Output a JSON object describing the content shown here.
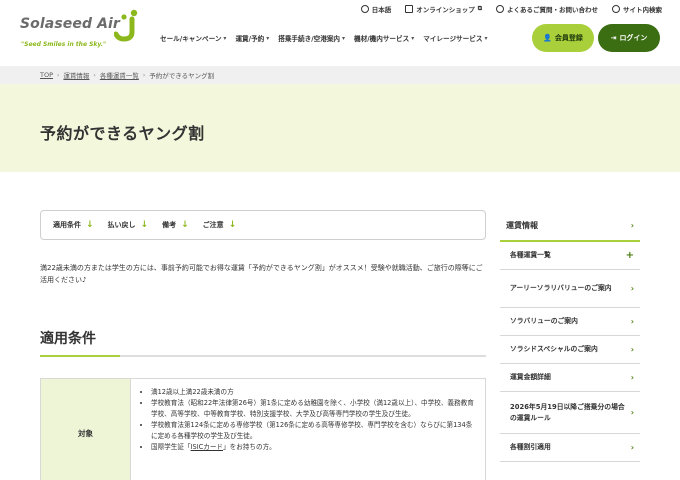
{
  "utility": {
    "language": "日本語",
    "shop": "オンラインショップ",
    "faq": "よくあるご質問・お問い合わせ",
    "search": "サイト内検索"
  },
  "brand": {
    "name": "Solaseed Air",
    "tagline": "\"Seed Smiles in the Sky.\"",
    "accent": "#a9d03a",
    "dark_green": "#3b6d12"
  },
  "gnav": [
    "セール/キャンペーン",
    "運賃/予約",
    "搭乗手続き/空港案内",
    "機材/機内サービス",
    "マイレージサービス"
  ],
  "buttons": {
    "member": "会員登録",
    "login": "ログイン"
  },
  "breadcrumb": [
    "TOP",
    "運賃情報",
    "各種運賃一覧",
    "予約ができるヤング割"
  ],
  "page_title": "予約ができるヤング割",
  "anchors": [
    "適用条件",
    "払い戻し",
    "備考",
    "ご注意"
  ],
  "intro": "満22歳未満の方または学生の方には、事前予約可能でお得な運賃「予約ができるヤング割」がオススメ！受験や就職活動、ご旅行の際等にご活用ください♪",
  "section_title": "適用条件",
  "table": {
    "head": "対象",
    "items": [
      "満12歳以上満22歳未満の方",
      "学校教育法（昭和22年法律第26号）第1条に定める幼稚園を除く、小学校（満12歳以上）、中学校、義務教育学校、高等学校、中等教育学校、特別支援学校、大学及び高等専門学校の学生及び生徒。",
      "学校教育法第124条に定める専修学校（第126条に定める高等専修学校、専門学校を含む）ならびに第134条に定める各種学校の学生及び生徒。"
    ],
    "isic_prefix": "国際学生証「",
    "isic_link": "ISICカード",
    "isic_suffix": "」をお持ちの方。"
  },
  "sidebar": {
    "title": "運賃情報",
    "items": [
      "各種運賃一覧",
      "アーリーソラリバリューのご案内",
      "ソラバリューのご案内",
      "ソラシドスペシャルのご案内",
      "運賃金額詳細",
      "2026年5月19日以降ご搭乗分の場合の運賃ルール",
      "各種割引適用"
    ]
  }
}
